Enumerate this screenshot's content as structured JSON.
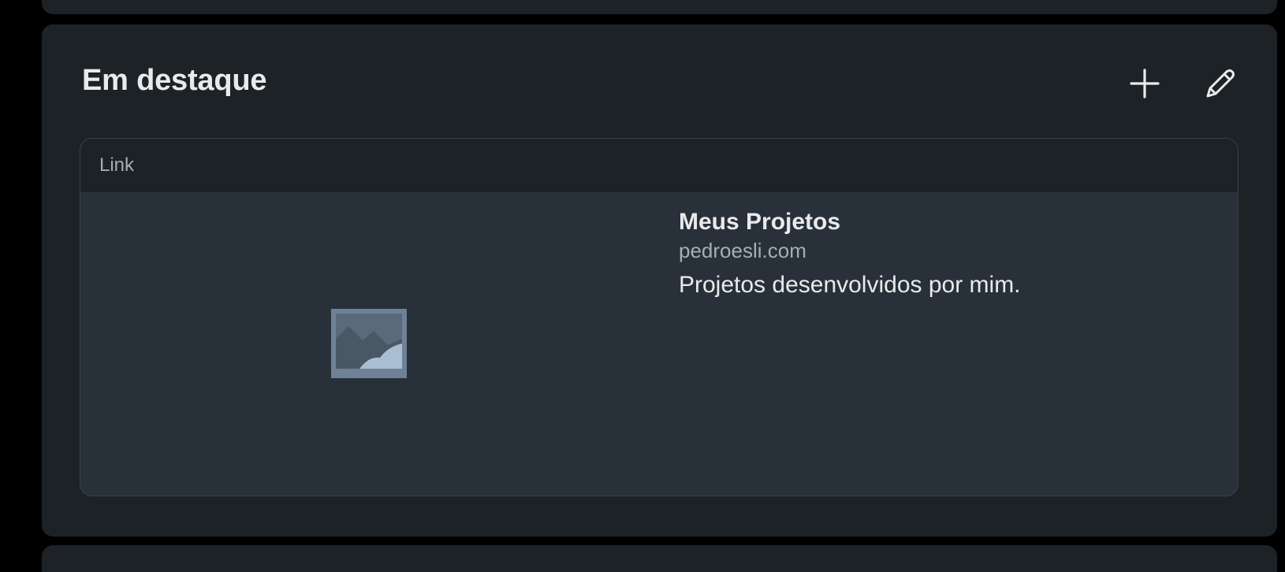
{
  "section": {
    "title": "Em destaque",
    "add_icon": "plus-icon",
    "edit_icon": "pencil-icon"
  },
  "featured": {
    "type_label": "Link",
    "title": "Meus Projetos",
    "domain": "pedroesli.com",
    "description": "Projetos desenvolvidos por mim.",
    "thumbnail_icon": "image-placeholder-icon"
  },
  "colors": {
    "background": "#000000",
    "card": "#1d2226",
    "item_body": "#28313a",
    "text_primary": "#e9eaeb",
    "text_secondary": "#a7adb3",
    "moon_accent": "#f5c46c"
  }
}
